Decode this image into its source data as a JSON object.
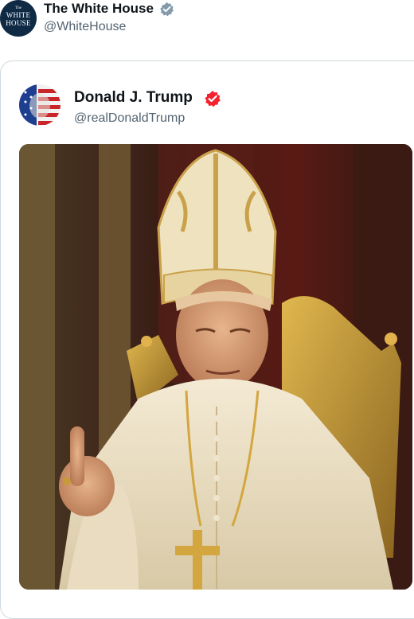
{
  "quoting_account": {
    "avatar_text": {
      "line1": "The",
      "line2": "WHITE",
      "line3": "HOUSE"
    },
    "name": "The White House",
    "handle": "@WhiteHouse",
    "badge": "verified-gray-badge-icon"
  },
  "quoted_post": {
    "name": "Donald J. Trump",
    "handle": "@realDonaldTrump",
    "badge": "verified-red-badge-icon",
    "media": "image of a man in papal vestments and mitre seated on a gold throne, raising one finger"
  },
  "colors": {
    "text_primary": "#0f1419",
    "text_secondary": "#536471",
    "border": "#cfd9de",
    "badge_gray": "#829aab",
    "badge_red": "#f4212e",
    "wh_avatar_bg": "#0f2a44"
  }
}
